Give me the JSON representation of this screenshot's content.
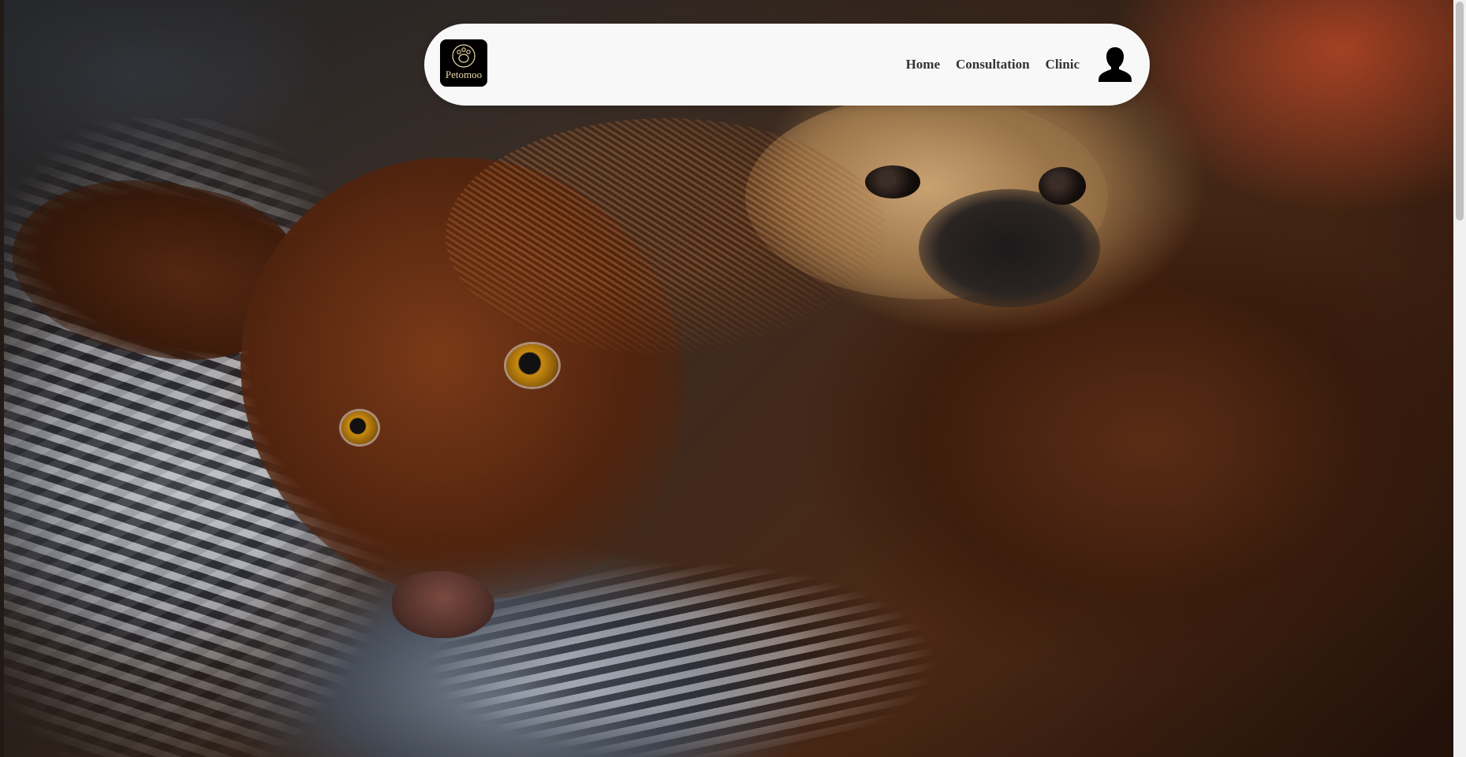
{
  "brand": {
    "name": "Petomoo",
    "logo_icon": "dog-paw-logo-icon"
  },
  "nav": {
    "links": [
      {
        "label": "Home"
      },
      {
        "label": "Consultation"
      },
      {
        "label": "Clinic"
      }
    ],
    "profile_icon": "user-silhouette-icon"
  },
  "hero": {
    "image": "hero-dogs-photo"
  },
  "colors": {
    "navbar_bg": "#f8f8f8",
    "nav_text": "#333333",
    "logo_bg": "#000000",
    "logo_text": "#e9d9a3"
  }
}
